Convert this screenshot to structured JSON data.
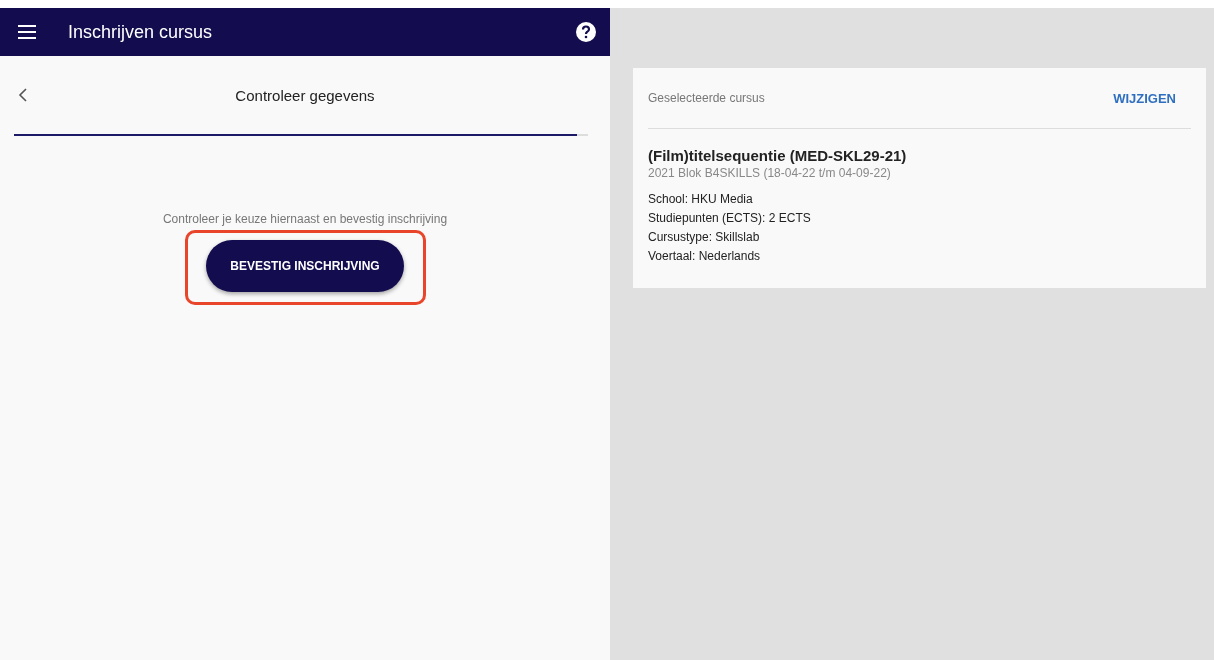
{
  "app_bar": {
    "title": "Inschrijven cursus"
  },
  "step": {
    "title": "Controleer gegevens",
    "progress": {
      "level": 0.98
    }
  },
  "instruction": "Controleer je keuze hiernaast en bevestig inschrijving",
  "confirm_button": {
    "label": "BEVESTIG INSCHRIJVING",
    "highlighted": true
  },
  "course_card": {
    "heading": "Geselecteerde cursus",
    "action": "WIJZIGEN",
    "name": "(Film)titelsequentie (MED-SKL29-21)",
    "period": "2021 Blok B4SKILLS (18-04-22 t/m 04-09-22)",
    "details": [
      "School: HKU Media",
      "Studiepunten (ECTS): 2 ECTS",
      "Cursustype: Skillslab",
      "Voertaal: Nederlands"
    ]
  }
}
